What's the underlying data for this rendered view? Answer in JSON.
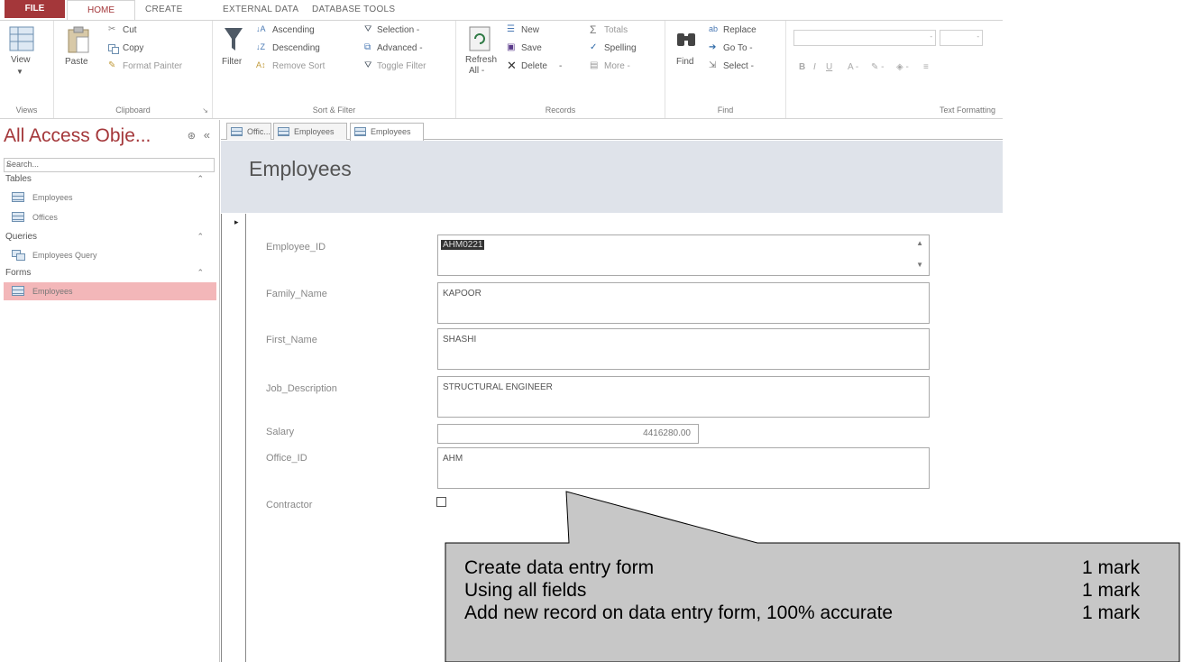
{
  "ribbon_tabs": {
    "file": "FILE",
    "home": "HOME",
    "create": "CREATE",
    "external_data": "EXTERNAL DATA",
    "database_tools": "DATABASE TOOLS"
  },
  "ribbon": {
    "views": {
      "view_label": "View",
      "group": "Views"
    },
    "clipboard": {
      "paste": "Paste",
      "cut": "Cut",
      "copy": "Copy",
      "format_painter": "Format Painter",
      "group": "Clipboard"
    },
    "sort_filter": {
      "filter": "Filter",
      "ascending": "Ascending",
      "descending": "Descending",
      "remove_sort": "Remove Sort",
      "selection": "Selection -",
      "advanced": "Advanced -",
      "toggle_filter": "Toggle Filter",
      "group": "Sort & Filter"
    },
    "records": {
      "refresh": "Refresh",
      "refresh_all": "All -",
      "new": "New",
      "save": "Save",
      "delete": "Delete",
      "totals": "Totals",
      "spelling": "Spelling",
      "more": "More -",
      "group": "Records"
    },
    "find": {
      "find": "Find",
      "replace": "Replace",
      "go_to": "Go To -",
      "select": "Select -",
      "group": "Find"
    },
    "text_formatting": {
      "group": "Text Formatting"
    }
  },
  "nav_pane": {
    "title": "All Access Obje...",
    "collapse": "«",
    "search_placeholder": "Search...",
    "sections": {
      "tables": "Tables",
      "queries": "Queries",
      "forms": "Forms"
    },
    "tables": [
      "Employees",
      "Offices"
    ],
    "queries": [
      "Employees Query"
    ],
    "forms": [
      "Employees"
    ]
  },
  "doc_tabs": [
    "Offic...",
    "Employees",
    "Employees"
  ],
  "form": {
    "title": "Employees",
    "record_marker": "▸",
    "fields": {
      "employee_id": {
        "label": "Employee_ID",
        "value": "AHM0221"
      },
      "family_name": {
        "label": "Family_Name",
        "value": "KAPOOR"
      },
      "first_name": {
        "label": "First_Name",
        "value": "SHASHI"
      },
      "job_description": {
        "label": "Job_Description",
        "value": "STRUCTURAL ENGINEER"
      },
      "salary": {
        "label": "Salary",
        "value": "4416280.00"
      },
      "office_id": {
        "label": "Office_ID",
        "value": "AHM"
      },
      "contractor": {
        "label": "Contractor",
        "checked": false
      }
    }
  },
  "callout": {
    "lines": [
      {
        "text": "Create data entry form",
        "mark": "1 mark"
      },
      {
        "text": "Using all fields",
        "mark": "1 mark"
      },
      {
        "text": "Add new record on data entry form, 100% accurate",
        "mark": "1 mark"
      }
    ]
  },
  "colors": {
    "accent": "#a4373a",
    "selected_nav": "#f3b7b9",
    "header_band": "#dfe3ea",
    "callout_fill": "#c7c7c7"
  }
}
